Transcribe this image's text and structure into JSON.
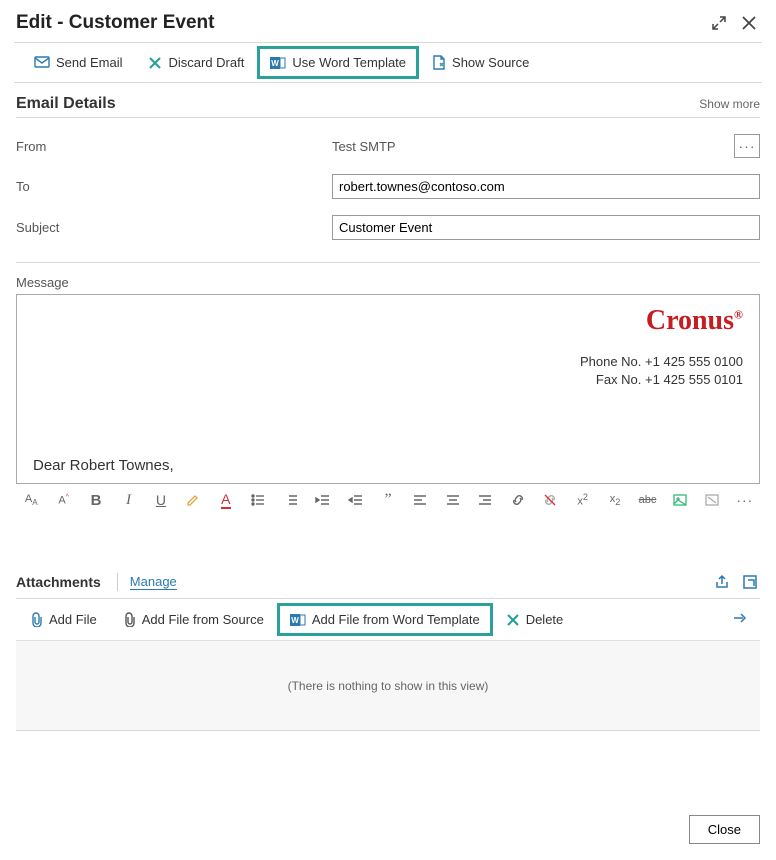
{
  "header": {
    "title": "Edit - Customer Event"
  },
  "toolbar": {
    "send": "Send Email",
    "discard": "Discard Draft",
    "word": "Use Word Template",
    "showsrc": "Show Source"
  },
  "details": {
    "heading": "Email Details",
    "showmore": "Show more",
    "from_label": "From",
    "from_value": "Test SMTP",
    "to_label": "To",
    "to_value": "robert.townes@contoso.com",
    "subject_label": "Subject",
    "subject_value": "Customer Event"
  },
  "message": {
    "label": "Message",
    "brand": "Cronus",
    "brand_symbol": "®",
    "phone_label": "Phone No.",
    "phone_value": "+1 425 555 0100",
    "fax_label": "Fax No.",
    "fax_value": "+1 425 555 0101",
    "salutation": "Dear Robert Townes,"
  },
  "attachments": {
    "heading": "Attachments",
    "manage": "Manage",
    "add_file": "Add File",
    "add_file_source": "Add File from Source",
    "add_file_word": "Add File from Word Template",
    "delete": "Delete",
    "empty": "(There is nothing to show in this view)"
  },
  "footer": {
    "close": "Close"
  }
}
